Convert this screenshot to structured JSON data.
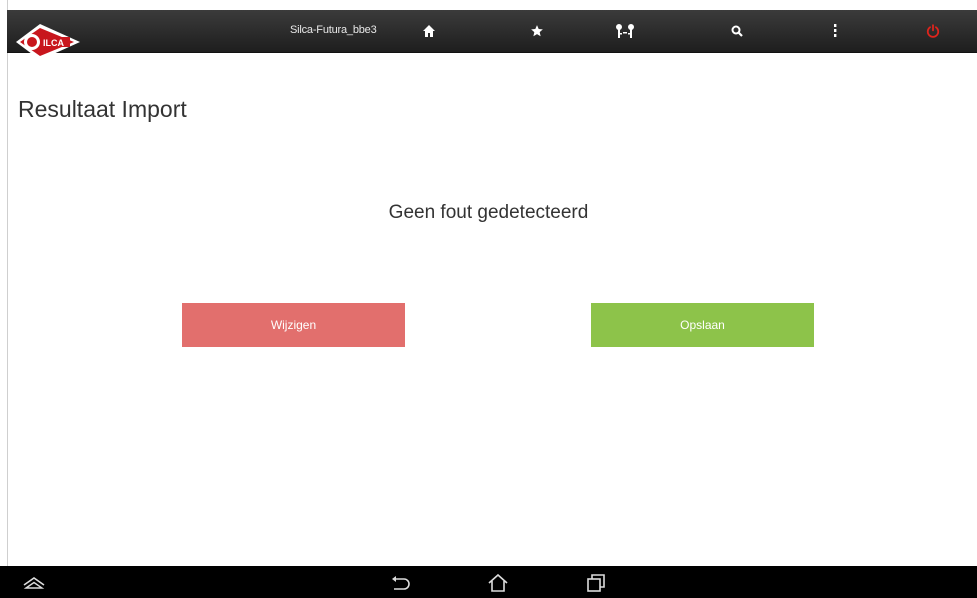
{
  "topbar": {
    "device_name": "Silca-Futura_bbe3",
    "icons": {
      "home": "home-icon",
      "favorites": "star-icon",
      "keys": "keys-icon",
      "search": "search-icon",
      "menu": "more-vertical-icon",
      "power": "power-icon"
    },
    "logo_text": "SILCA",
    "power_color": "#e0241c"
  },
  "page": {
    "title": "Resultaat Import",
    "message": "Geen fout gedetecteerd"
  },
  "buttons": {
    "edit_label": "Wijzigen",
    "save_label": "Opslaan",
    "edit_color": "#e26f6d",
    "save_color": "#8dc34a"
  },
  "navbar": {
    "icons": [
      "expand-icon",
      "back-icon",
      "home-icon",
      "recent-apps-icon"
    ]
  }
}
